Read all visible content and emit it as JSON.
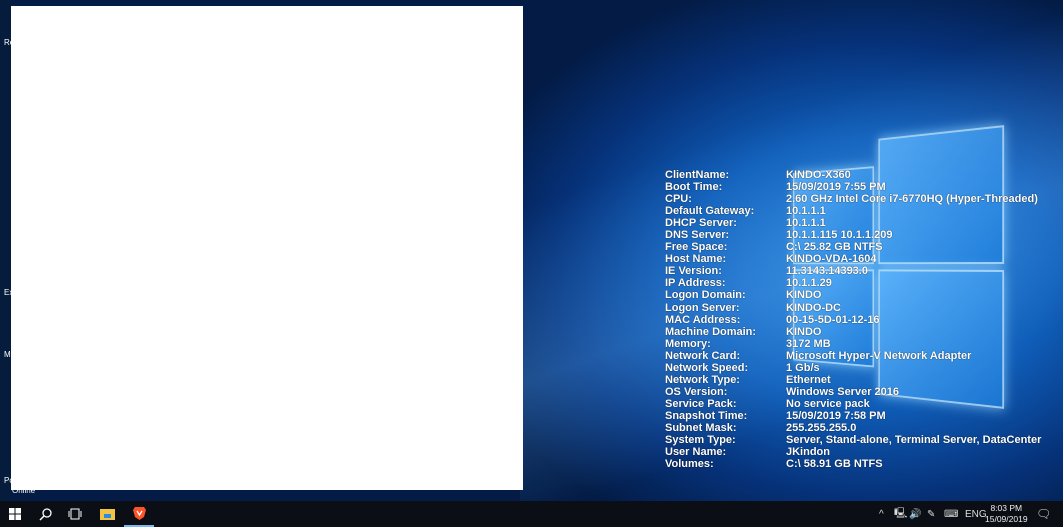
{
  "desktop": {
    "icon_labels": [
      "Re",
      "Ex",
      "M",
      "Po",
      "Online"
    ]
  },
  "bginfo": [
    {
      "label": "ClientName:",
      "value": "KINDO-X360"
    },
    {
      "label": "Boot Time:",
      "value": "15/09/2019 7:55 PM"
    },
    {
      "label": "CPU:",
      "value": "2.60 GHz Intel Core i7-6770HQ (Hyper-Threaded)"
    },
    {
      "label": "Default Gateway:",
      "value": "10.1.1.1"
    },
    {
      "label": "DHCP Server:",
      "value": "10.1.1.1"
    },
    {
      "label": "DNS Server:",
      "value": "10.1.1.115 10.1.1.209"
    },
    {
      "label": "Free Space:",
      "value": "C:\\ 25.82 GB NTFS"
    },
    {
      "label": "Host Name:",
      "value": "KINDO-VDA-1604"
    },
    {
      "label": "IE Version:",
      "value": "11.3143.14393.0"
    },
    {
      "label": "IP Address:",
      "value": "10.1.1.29"
    },
    {
      "label": "Logon Domain:",
      "value": "KINDO"
    },
    {
      "label": "Logon Server:",
      "value": "KINDO-DC"
    },
    {
      "label": "MAC Address:",
      "value": "00-15-5D-01-12-16"
    },
    {
      "label": "Machine Domain:",
      "value": "KINDO"
    },
    {
      "label": "Memory:",
      "value": "3172 MB"
    },
    {
      "label": "Network Card:",
      "value": "Microsoft Hyper-V Network Adapter"
    },
    {
      "label": "Network Speed:",
      "value": "1 Gb/s"
    },
    {
      "label": "Network Type:",
      "value": "Ethernet"
    },
    {
      "label": "OS Version:",
      "value": "Windows Server 2016"
    },
    {
      "label": "Service Pack:",
      "value": "No service pack"
    },
    {
      "label": "Snapshot Time:",
      "value": "15/09/2019 7:58 PM"
    },
    {
      "label": "Subnet Mask:",
      "value": "255.255.255.0"
    },
    {
      "label": "System Type:",
      "value": "Server, Stand-alone, Terminal Server, DataCenter"
    },
    {
      "label": "User Name:",
      "value": "JKindon"
    },
    {
      "label": "Volumes:",
      "value": "C:\\ 58.91 GB NTFS"
    }
  ],
  "taskbar": {
    "icons": [
      "windows-start-icon",
      "search-icon",
      "task-view-icon",
      "file-explorer-icon",
      "brave-browser-icon"
    ],
    "tray": {
      "language": "ENG",
      "time": "8:03 PM",
      "date": "15/09/2019"
    }
  }
}
